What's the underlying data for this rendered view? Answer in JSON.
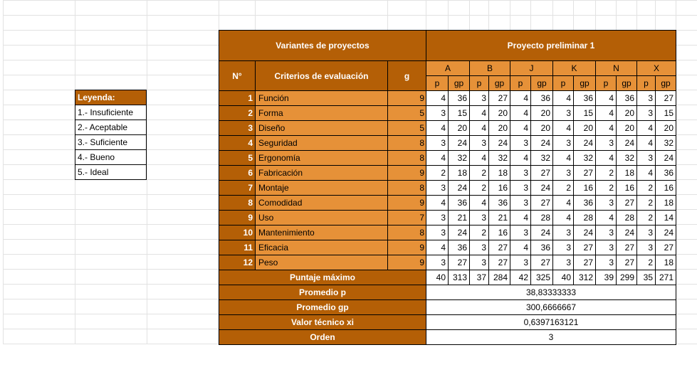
{
  "legend": {
    "title": "Leyenda:",
    "items": [
      "1.- Insuficiente",
      "2.- Aceptable",
      "3.- Suficiente",
      "4.- Bueno",
      "5.- Ideal"
    ]
  },
  "table": {
    "header_variants": "Variantes de proyectos",
    "header_project": "Proyecto preliminar 1",
    "col_no": "N°",
    "col_criteria": "Criterios de evaluación",
    "col_g": "g",
    "columns": [
      "A",
      "B",
      "J",
      "K",
      "N",
      "X"
    ],
    "sub_p": "p",
    "sub_gp": "gp",
    "rows": [
      {
        "n": "1",
        "criterio": "Función",
        "g": "9",
        "vals": [
          "4",
          "36",
          "3",
          "27",
          "4",
          "36",
          "4",
          "36",
          "4",
          "36",
          "3",
          "27"
        ]
      },
      {
        "n": "2",
        "criterio": "Forma",
        "g": "5",
        "vals": [
          "3",
          "15",
          "4",
          "20",
          "4",
          "20",
          "3",
          "15",
          "4",
          "20",
          "3",
          "15"
        ]
      },
      {
        "n": "3",
        "criterio": "Diseño",
        "g": "5",
        "vals": [
          "4",
          "20",
          "4",
          "20",
          "4",
          "20",
          "4",
          "20",
          "4",
          "20",
          "4",
          "20"
        ]
      },
      {
        "n": "4",
        "criterio": "Seguridad",
        "g": "8",
        "vals": [
          "3",
          "24",
          "3",
          "24",
          "3",
          "24",
          "3",
          "24",
          "3",
          "24",
          "4",
          "32"
        ]
      },
      {
        "n": "5",
        "criterio": "Ergonomía",
        "g": "8",
        "vals": [
          "4",
          "32",
          "4",
          "32",
          "4",
          "32",
          "4",
          "32",
          "4",
          "32",
          "3",
          "24"
        ]
      },
      {
        "n": "6",
        "criterio": "Fabricación",
        "g": "9",
        "vals": [
          "2",
          "18",
          "2",
          "18",
          "3",
          "27",
          "3",
          "27",
          "2",
          "18",
          "4",
          "36"
        ]
      },
      {
        "n": "7",
        "criterio": "Montaje",
        "g": "8",
        "vals": [
          "3",
          "24",
          "2",
          "16",
          "3",
          "24",
          "2",
          "16",
          "2",
          "16",
          "2",
          "16"
        ]
      },
      {
        "n": "8",
        "criterio": "Comodidad",
        "g": "9",
        "vals": [
          "4",
          "36",
          "4",
          "36",
          "3",
          "27",
          "4",
          "36",
          "3",
          "27",
          "2",
          "18"
        ]
      },
      {
        "n": "9",
        "criterio": "Uso",
        "g": "7",
        "vals": [
          "3",
          "21",
          "3",
          "21",
          "4",
          "28",
          "4",
          "28",
          "4",
          "28",
          "2",
          "14"
        ]
      },
      {
        "n": "10",
        "criterio": "Mantenimiento",
        "g": "8",
        "vals": [
          "3",
          "24",
          "2",
          "16",
          "3",
          "24",
          "3",
          "24",
          "3",
          "24",
          "3",
          "24"
        ]
      },
      {
        "n": "11",
        "criterio": "Eficacia",
        "g": "9",
        "vals": [
          "4",
          "36",
          "3",
          "27",
          "4",
          "36",
          "3",
          "27",
          "3",
          "27",
          "3",
          "27"
        ]
      },
      {
        "n": "12",
        "criterio": "Peso",
        "g": "9",
        "vals": [
          "3",
          "27",
          "3",
          "27",
          "3",
          "27",
          "3",
          "27",
          "3",
          "27",
          "2",
          "18"
        ]
      }
    ],
    "puntaje_label": "Puntaje máximo",
    "puntaje_vals": [
      "40",
      "313",
      "37",
      "284",
      "42",
      "325",
      "40",
      "312",
      "39",
      "299",
      "35",
      "271"
    ],
    "promedio_p_label": "Promedio p",
    "promedio_p": "38,83333333",
    "promedio_gp_label": "Promedio gp",
    "promedio_gp": "300,6666667",
    "valor_label": "Valor técnico xi",
    "valor": "0,6397163121",
    "orden_label": "Orden",
    "orden": "3"
  },
  "colors": {
    "dark_orange": "#b45f06",
    "light_orange": "#e69138",
    "grid": "#e2e2e2"
  }
}
